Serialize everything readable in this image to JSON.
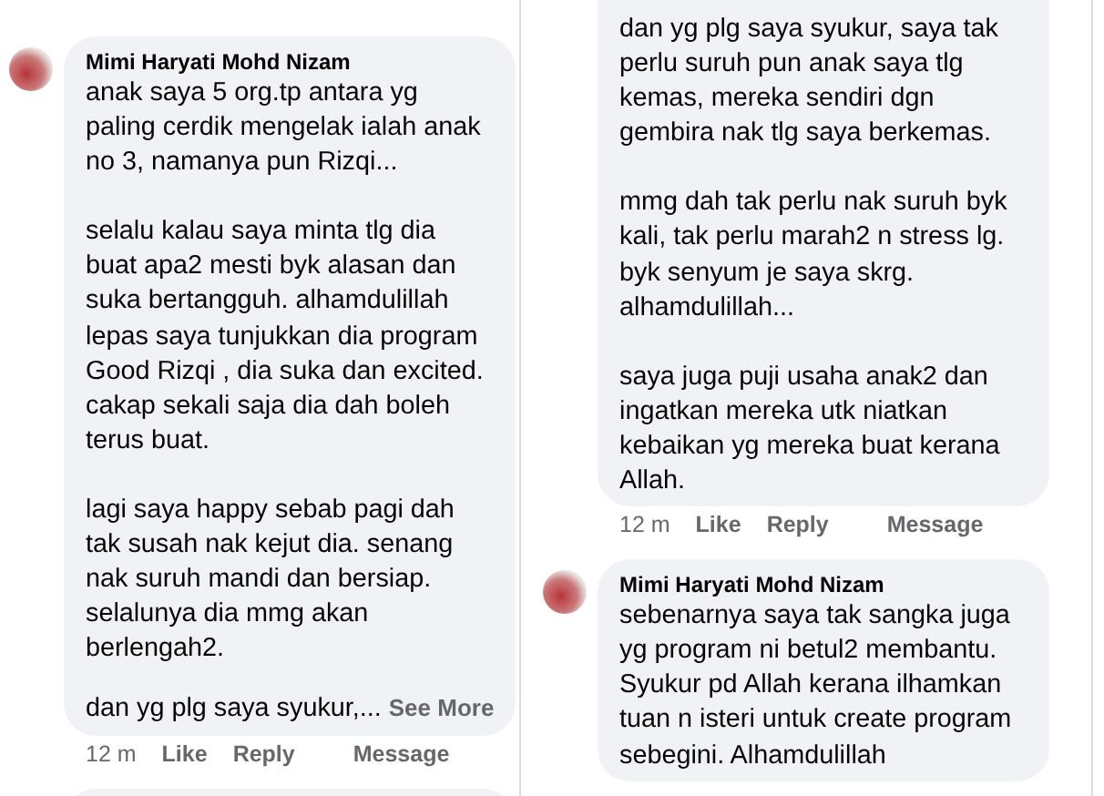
{
  "columns": [
    {
      "comments": [
        {
          "author": "Mimi Haryati Mohd Nizam",
          "paragraphs": [
            "anak saya 5 org.tp antara yg\npaling cerdik mengelak ialah anak\nno 3, namanya pun Rizqi...",
            "selalu kalau saya minta tlg dia\nbuat apa2 mesti byk alasan dan\nsuka bertangguh. alhamdulillah\nlepas saya tunjukkan dia program\nGood Rizqi , dia suka dan excited.\ncakap sekali saja dia dah boleh\nterus buat.",
            "lagi saya happy sebab pagi dah\ntak susah nak kejut dia. senang\nnak suruh mandi dan bersiap.\nselalunya dia mmg akan\nberlengah2.",
            "dan yg plg saya syukur,..."
          ],
          "see_more": "See More",
          "time": "12 m",
          "actions": [
            "Like",
            "Reply",
            "Message"
          ]
        }
      ]
    },
    {
      "comments": [
        {
          "paragraphs": [
            "dan yg plg saya syukur, saya tak\nperlu suruh pun anak saya tlg\nkemas, mereka sendiri dgn\ngembira nak tlg saya berkemas.",
            "mmg dah tak perlu nak suruh byk\nkali, tak perlu marah2 n stress lg.\nbyk senyum je saya skrg.\nalhamdulillah...",
            "saya juga puji usaha anak2 dan\ningatkan mereka utk niatkan\nkebaikan yg mereka buat kerana\nAllah."
          ],
          "time": "12 m",
          "actions": [
            "Like",
            "Reply",
            "Message"
          ]
        },
        {
          "author": "Mimi Haryati Mohd Nizam",
          "paragraphs": [
            "sebenarnya saya tak sangka juga\nyg program ni betul2 membantu.\nSyukur pd Allah kerana ilhamkan\ntuan n isteri untuk create program\nsebegini. Alhamdulillah"
          ]
        }
      ]
    }
  ]
}
